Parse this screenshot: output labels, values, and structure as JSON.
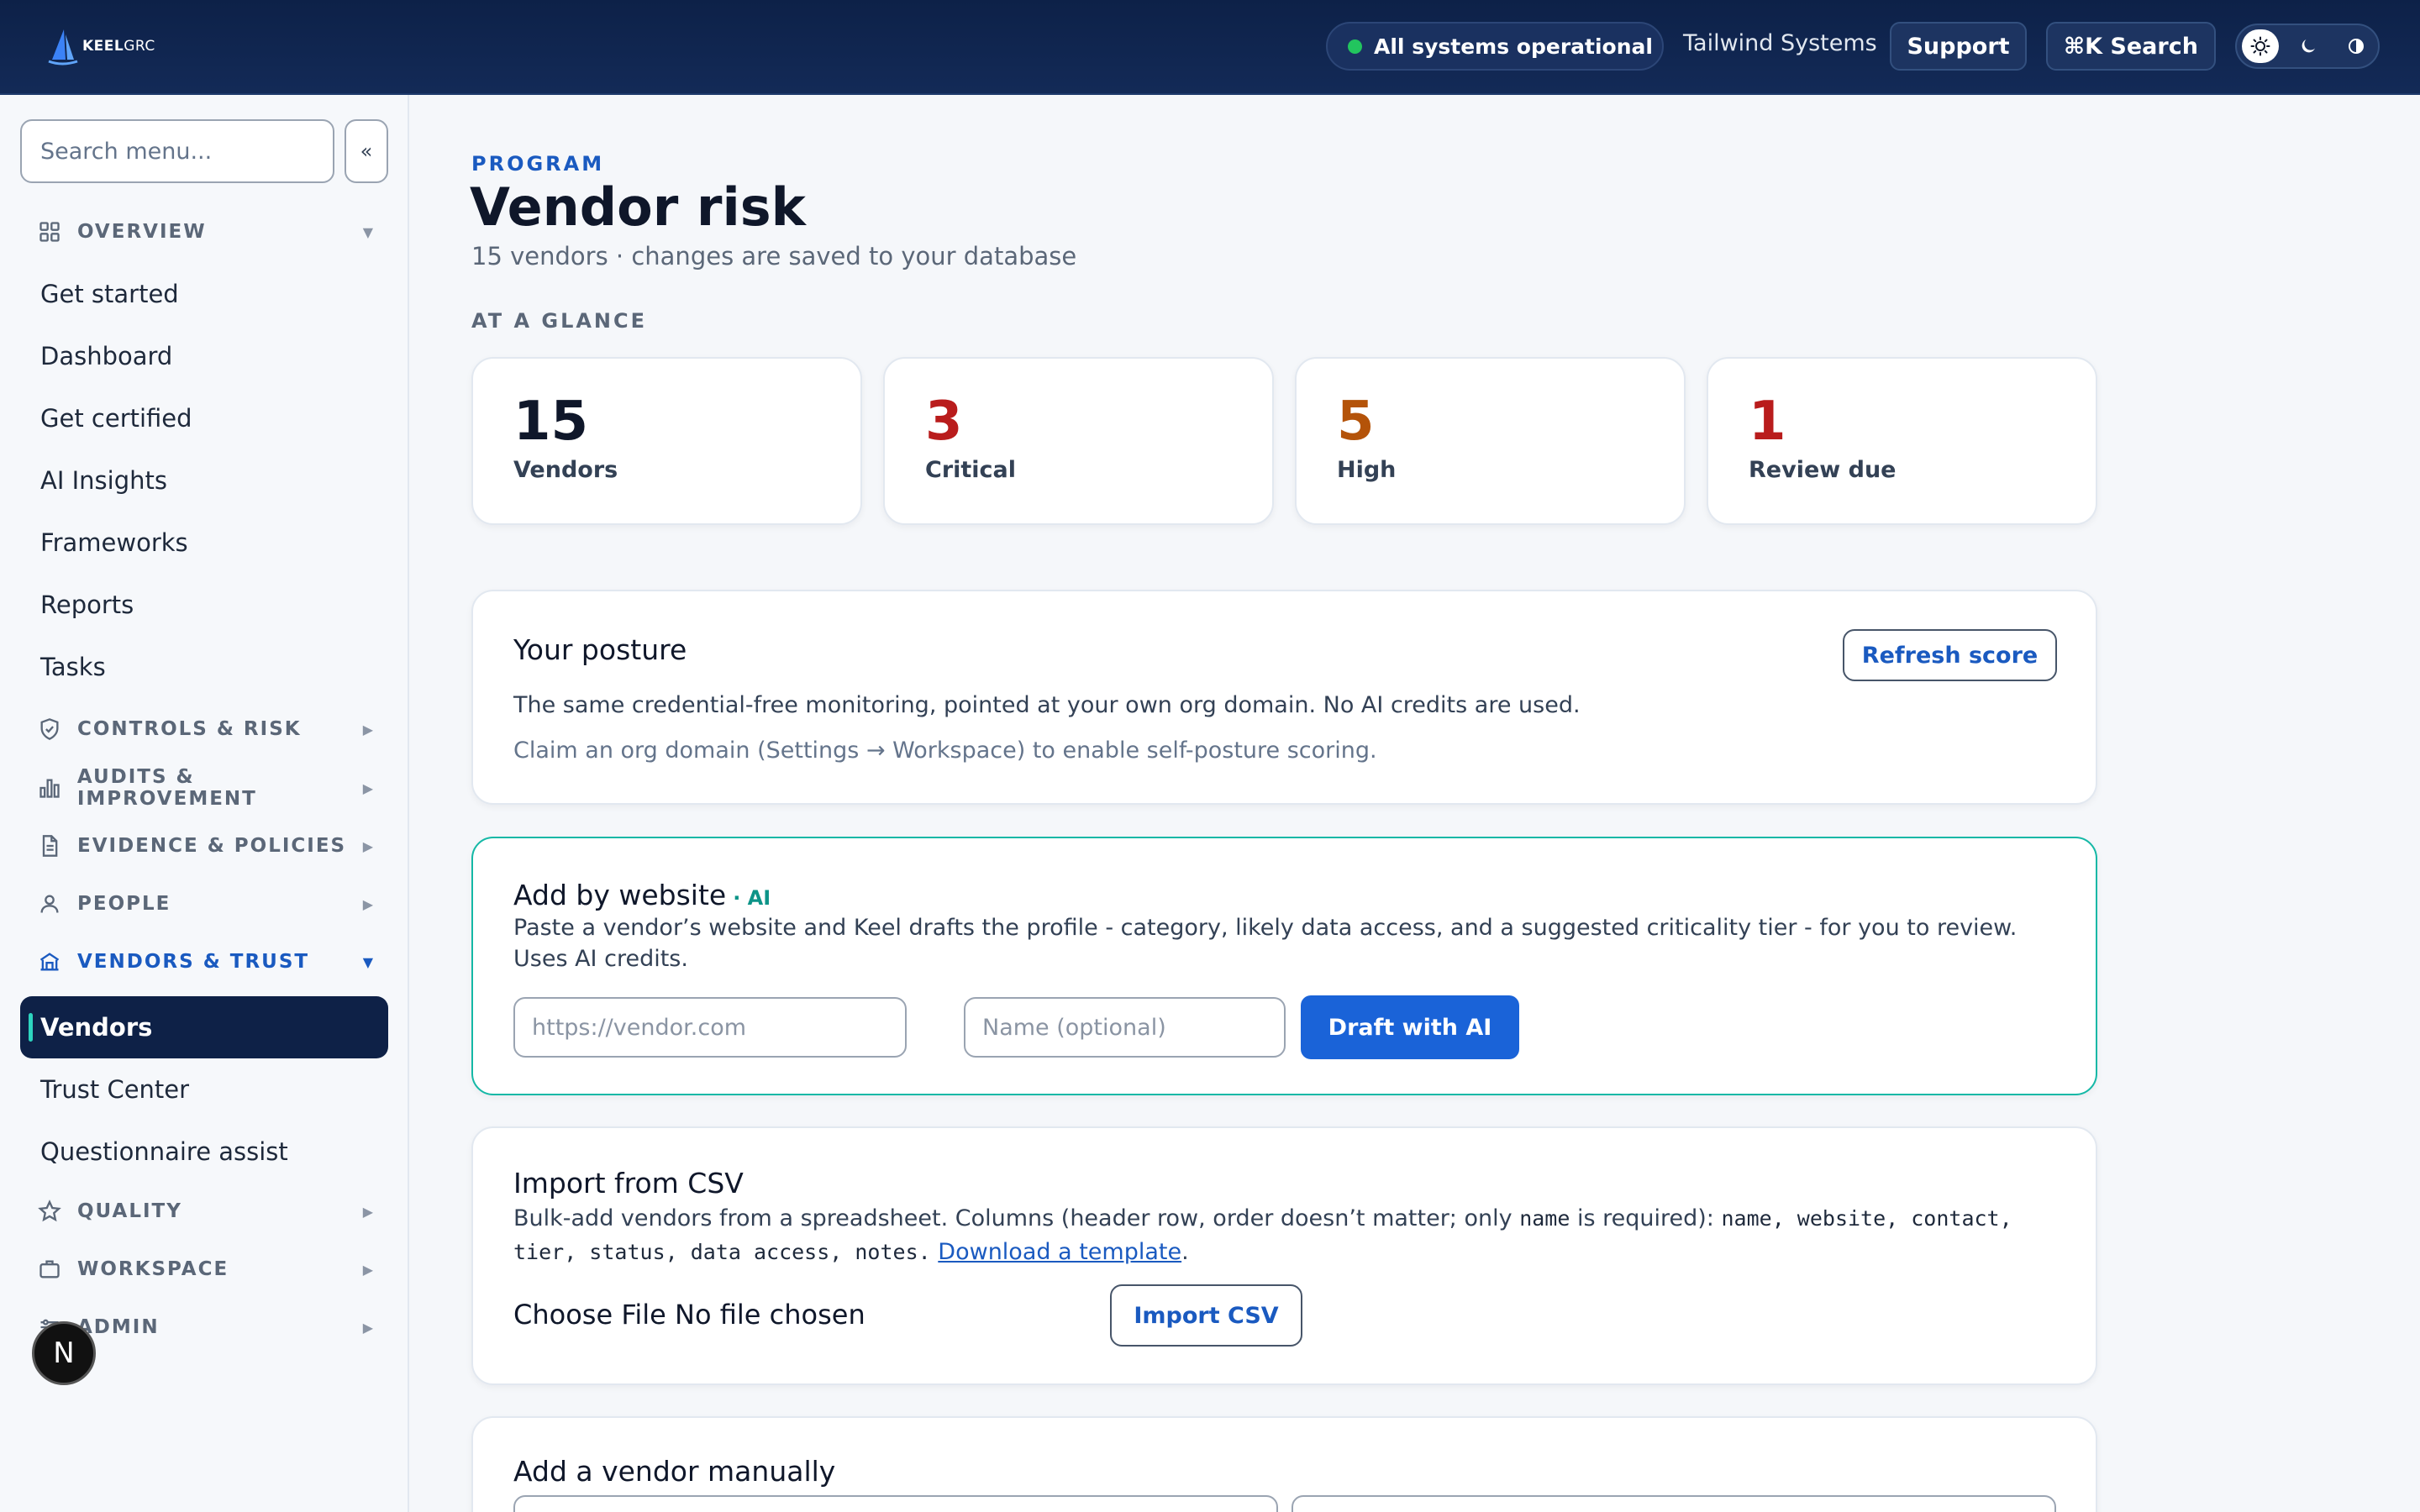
{
  "header": {
    "logo_bold": "KEEL",
    "logo_light": "GRC",
    "status_text": "All systems operational",
    "org_name": "Tailwind Systems",
    "support_label": "Support",
    "search_label": "⌘K Search",
    "theme_options": [
      "light",
      "dark",
      "contrast"
    ],
    "theme_selected": "light"
  },
  "sidebar": {
    "search_placeholder": "Search menu...",
    "collapse_label": "«",
    "sections": {
      "overview": "OVERVIEW",
      "controls": "CONTROLS & RISK",
      "audits": "AUDITS & IMPROVEMENT",
      "evidence": "EVIDENCE & POLICIES",
      "people": "PEOPLE",
      "vendors_trust": "VENDORS & TRUST",
      "quality": "QUALITY",
      "workspace": "WORKSPACE",
      "admin": "ADMIN"
    },
    "overview_items": [
      "Get started",
      "Dashboard",
      "Get certified",
      "AI Insights",
      "Frameworks",
      "Reports",
      "Tasks"
    ],
    "vendor_items": [
      "Vendors",
      "Trust Center",
      "Questionnaire assist"
    ],
    "active_item": "Vendors",
    "avatar_letter": "N"
  },
  "page": {
    "eyebrow": "PROGRAM",
    "title": "Vendor risk",
    "subtitle": "15 vendors · changes are saved to your database",
    "glance_label": "AT A GLANCE"
  },
  "stats": [
    {
      "value": "15",
      "label": "Vendors",
      "color": "#0f172a"
    },
    {
      "value": "3",
      "label": "Critical",
      "color": "#b91c1c"
    },
    {
      "value": "5",
      "label": "High",
      "color": "#b45309"
    },
    {
      "value": "1",
      "label": "Review due",
      "color": "#b91c1c"
    }
  ],
  "posture": {
    "title": "Your posture",
    "button": "Refresh score",
    "text": "The same credential-free monitoring, pointed at your own org domain. No AI credits are used.",
    "hint": "Claim an org domain (Settings → Workspace) to enable self-posture scoring."
  },
  "add_website": {
    "title": "Add by website",
    "ai_tag": "· AI",
    "text": "Paste a vendor’s website and Keel drafts the profile - category, likely data access, and a suggested criticality tier - for you to review. Uses AI credits.",
    "url_placeholder": "https://vendor.com",
    "name_placeholder": "Name (optional)",
    "button": "Draft with AI"
  },
  "import_csv": {
    "title": "Import from CSV",
    "text_start": "Bulk-add vendors from a spreadsheet. Columns (header row, order doesn’t matter; only ",
    "text_name": "name",
    "text_mid": " is required): ",
    "columns": "name, website, contact, tier, status, data access, notes.",
    "link": "Download a template",
    "link_end": ".",
    "file_label": "Choose File No file chosen",
    "button": "Import CSV"
  },
  "manual": {
    "title": "Add a vendor manually"
  },
  "colors": {
    "accent": "#1a5ac0",
    "nav_active_bg": "#0e2147",
    "ai_border": "#14b8a6",
    "status_ok": "#22c55e"
  }
}
